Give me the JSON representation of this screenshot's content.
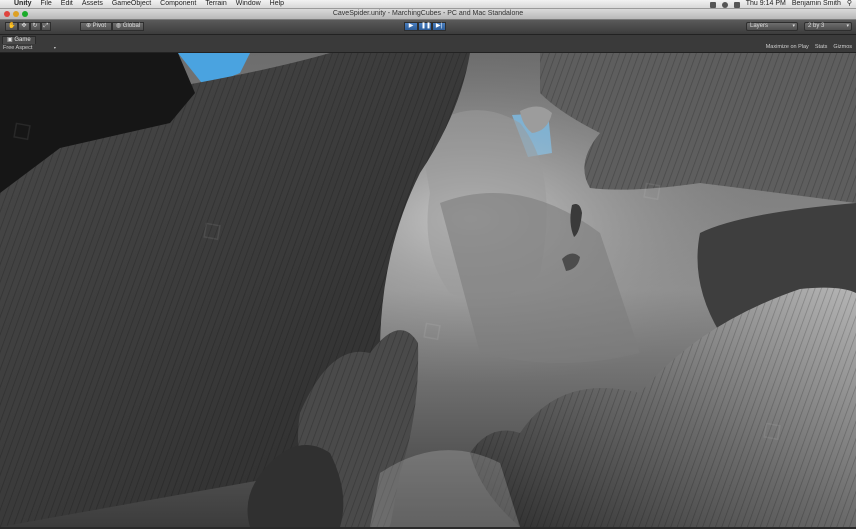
{
  "menubar": {
    "apple_icon": "apple-icon",
    "items": [
      "Unity",
      "File",
      "Edit",
      "Assets",
      "GameObject",
      "Component",
      "Terrain",
      "Window",
      "Help"
    ],
    "clock": "Thu 9:14 PM",
    "user": "Benjamin Smith"
  },
  "window": {
    "title": "CaveSpider.unity - MarchingCubes - PC and Mac Standalone"
  },
  "toolbar": {
    "tools": [
      "hand-icon",
      "move-icon",
      "rotate-icon",
      "scale-icon"
    ],
    "pivot_label": "Pivot",
    "global_label": "Global",
    "play_icons": [
      "play-icon",
      "pause-icon",
      "step-icon"
    ],
    "layers_label": "Layers",
    "layout_label": "2 by 3"
  },
  "game_view": {
    "tab_label": "Game",
    "aspect_label": "Free Aspect",
    "options": [
      "Maximize on Play",
      "Stats",
      "Gizmos"
    ]
  },
  "colors": {
    "play_active": "#2d5d99",
    "sky": "#4aa3e0",
    "rock_dark": "#2b2b2b",
    "rock_light": "#9a9a9a"
  }
}
